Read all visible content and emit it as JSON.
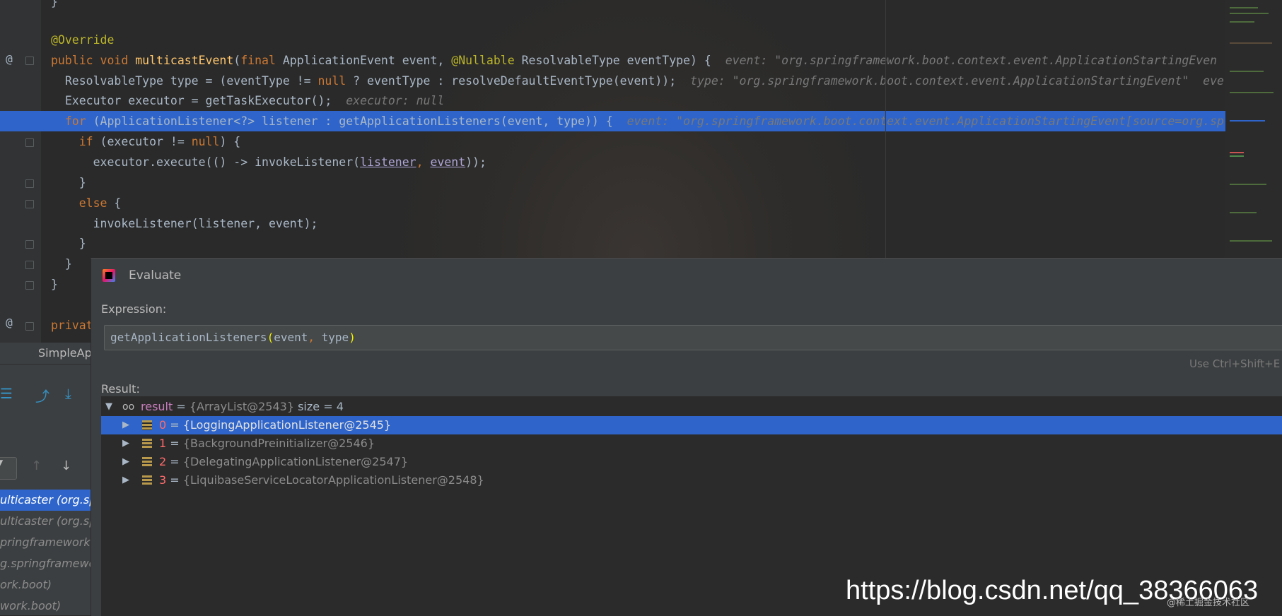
{
  "editor": {
    "lines": [
      {
        "parts": [
          [
            "}",
            "plain"
          ]
        ]
      },
      {
        "parts": [
          [
            "@Override",
            "ann"
          ]
        ]
      },
      {
        "parts": [
          [
            "public void ",
            "kw"
          ],
          [
            "multicastEvent",
            "fn"
          ],
          [
            "(",
            "plain"
          ],
          [
            "final ",
            "kw"
          ],
          [
            "ApplicationEvent event, ",
            "plain"
          ],
          [
            "@Nullable ",
            "ann"
          ],
          [
            "ResolvableType eventType) {  ",
            "plain"
          ],
          [
            "event: \"org.springframework.boot.context.event.ApplicationStartingEven",
            "hint"
          ]
        ]
      },
      {
        "parts": [
          [
            "  ResolvableType type = (eventType != ",
            "plain"
          ],
          [
            "null",
            "kw"
          ],
          [
            " ? eventType : resolveDefaultEventType(event));  ",
            "plain"
          ],
          [
            "type: \"org.springframework.boot.context.event.ApplicationStartingEvent\"  eve",
            "hint"
          ]
        ]
      },
      {
        "parts": [
          [
            "  Executor executor = getTaskExecutor();  ",
            "plain"
          ],
          [
            "executor: null",
            "hint"
          ]
        ]
      },
      {
        "parts": [
          [
            "  for ",
            "kw"
          ],
          [
            "(ApplicationListener<?> listener : getApplicationListeners(event, type)) {  ",
            "plain"
          ],
          [
            "event: \"org.springframework.boot.context.event.ApplicationStartingEvent[source=org.sp",
            "hint"
          ]
        ]
      },
      {
        "parts": [
          [
            "    if ",
            "kw"
          ],
          [
            "(executor != ",
            "plain"
          ],
          [
            "null",
            "kw"
          ],
          [
            ") {",
            "plain"
          ]
        ]
      },
      {
        "parts": [
          [
            "      executor.execute(() -> invokeListener(",
            "plain"
          ],
          [
            "listener",
            "ul"
          ],
          [
            ", ",
            "kw"
          ],
          [
            "event",
            "ul"
          ],
          [
            "));",
            "plain"
          ]
        ]
      },
      {
        "parts": [
          [
            "    }",
            "plain"
          ]
        ]
      },
      {
        "parts": [
          [
            "    else ",
            "kw"
          ],
          [
            "{",
            "plain"
          ]
        ]
      },
      {
        "parts": [
          [
            "      invokeListener(listener, event);",
            "plain"
          ]
        ]
      },
      {
        "parts": [
          [
            "    }",
            "plain"
          ]
        ]
      },
      {
        "parts": [
          [
            "  }",
            "plain"
          ]
        ]
      },
      {
        "parts": [
          [
            "}",
            "plain"
          ]
        ]
      },
      {
        "parts": [
          [
            "",
            "plain"
          ]
        ]
      },
      {
        "parts": [
          [
            "privat",
            "kw"
          ]
        ]
      }
    ]
  },
  "left_panel": {
    "tab_label": "SimpleAp",
    "frames": [
      "ulticaster (org.sp",
      "ulticaster (org.sp",
      "pringframework.",
      "g.springframewo",
      "ork.boot)",
      "work.boot)"
    ]
  },
  "dialog": {
    "title": "Evaluate",
    "expression_label": "Expression:",
    "expression": "getApplicationListeners(event, type)",
    "shortcut_hint": "Use Ctrl+Shift+E",
    "result_label": "Result:",
    "result": {
      "name": "result",
      "value": "{ArrayList@2543}",
      "size": "size = 4",
      "children": [
        {
          "index": "0",
          "value": "{LoggingApplicationListener@2545}"
        },
        {
          "index": "1",
          "value": "{BackgroundPreinitializer@2546}"
        },
        {
          "index": "2",
          "value": "{DelegatingApplicationListener@2547}"
        },
        {
          "index": "3",
          "value": "{LiquibaseServiceLocatorApplicationListener@2548}"
        }
      ]
    }
  },
  "watermark": {
    "url": "https://blog.csdn.net/qq_38366063",
    "credit": "@稀土掘金技术社区"
  }
}
